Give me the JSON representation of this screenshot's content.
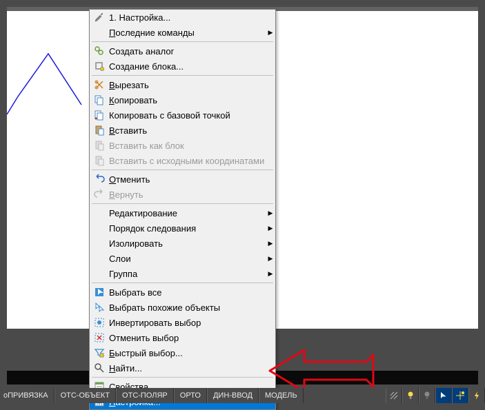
{
  "menu": {
    "settings_1": "1. Настройка...",
    "recent": "Последние команды",
    "create_analog": "Создать аналог",
    "create_block": "Создание блока...",
    "cut": "Вырезать",
    "copy": "Копировать",
    "copy_base": "Копировать с базовой точкой",
    "paste": "Вставить",
    "paste_block": "Вставить как блок",
    "paste_orig": "Вставить с исходными координатами",
    "undo": "Отменить",
    "redo": "Вернуть",
    "edit": "Редактирование",
    "draw_order": "Порядок следования",
    "isolate": "Изолировать",
    "layers": "Слои",
    "group": "Группа",
    "select_all": "Выбрать все",
    "select_similar": "Выбрать похожие объекты",
    "invert": "Инвертировать выбор",
    "deselect": "Отменить выбор",
    "quick_select": "Быстрый выбор...",
    "find": "Найти...",
    "properties": "Свойства...",
    "nastroika": "Настройка..."
  },
  "status": {
    "osnap": "оПРИВЯЗКА",
    "otsobj": "ОТС-ОБЪЕКТ",
    "otspolar": "ОТС-ПОЛЯР",
    "ortho": "ОРТО",
    "dyn": "ДИН-ВВОД",
    "model": "МОДЕЛЬ"
  }
}
